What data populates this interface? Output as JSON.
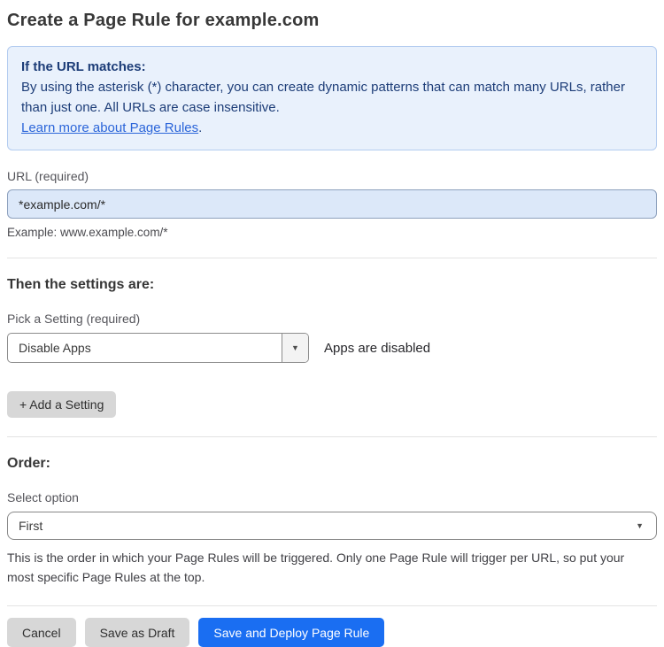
{
  "page": {
    "title": "Create a Page Rule for example.com"
  },
  "info_box": {
    "heading": "If the URL matches:",
    "body": "By using the asterisk (*) character, you can create dynamic patterns that can match many URLs, rather than just one. All URLs are case insensitive.",
    "link_label": "Learn more about Page Rules",
    "link_suffix": "."
  },
  "url_field": {
    "label": "URL (required)",
    "value": "*example.com/*",
    "example": "Example: www.example.com/*"
  },
  "settings_section": {
    "heading": "Then the settings are:",
    "setting_label": "Pick a Setting (required)",
    "setting_value": "Disable Apps",
    "setting_status": "Apps are disabled",
    "add_setting_label": "+ Add a Setting"
  },
  "order_section": {
    "heading": "Order:",
    "select_label": "Select option",
    "select_value": "First",
    "help_text": "This is the order in which your Page Rules will be triggered. Only one Page Rule will trigger per URL, so put your most specific Page Rules at the top."
  },
  "footer": {
    "cancel_label": "Cancel",
    "save_draft_label": "Save as Draft",
    "save_deploy_label": "Save and Deploy Page Rule"
  },
  "icons": {
    "caret_down": "▼"
  },
  "colors": {
    "accent_blue": "#1a6ef2",
    "info_box_bg": "#e9f1fc",
    "info_box_border": "#b3ccf0",
    "info_box_text": "#1d3d78",
    "link_blue": "#2b65d9",
    "url_input_bg": "#dce8f9",
    "gray_button_bg": "#d7d7d7"
  }
}
